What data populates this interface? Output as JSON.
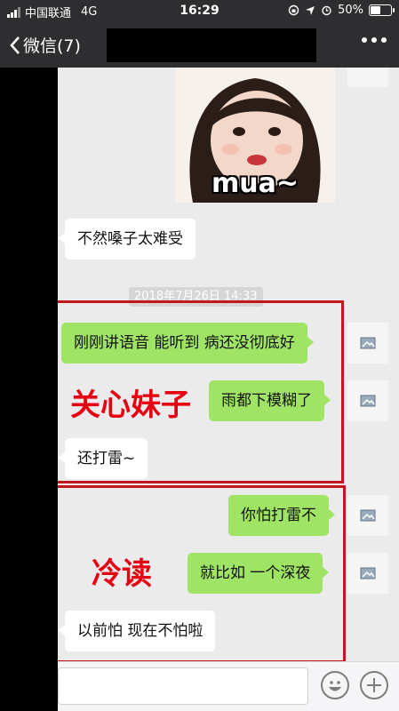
{
  "status_bar": {
    "carrier": "中国联通",
    "network": "4G",
    "time": "16:29",
    "battery": "50%",
    "battery_level": 0.5
  },
  "nav": {
    "back_label": "微信(7)"
  },
  "chat": {
    "sticker": {
      "caption": "mua~"
    },
    "timestamp": "2018年7月26日 14:33",
    "messages": [
      {
        "side": "in",
        "text": "不然嗓子太难受"
      },
      {
        "side": "out",
        "text": "刚刚讲语音 能听到 病还没彻底好"
      },
      {
        "side": "out",
        "text": "雨都下模糊了"
      },
      {
        "side": "in",
        "text": "还打雷~"
      },
      {
        "side": "out",
        "text": "你怕打雷不"
      },
      {
        "side": "out",
        "text": "就比如 一个深夜"
      },
      {
        "side": "in",
        "text": "以前怕  现在不怕啦"
      }
    ],
    "annotations": [
      {
        "text": "关心妹子",
        "color": "#e60012"
      },
      {
        "text": "冷读",
        "color": "#e60012"
      }
    ]
  },
  "colors": {
    "bar_bg": "#2e2e30",
    "chat_bg": "#ebebeb",
    "out_bubble": "#9fe465",
    "annotation_box": "#c4161c"
  }
}
